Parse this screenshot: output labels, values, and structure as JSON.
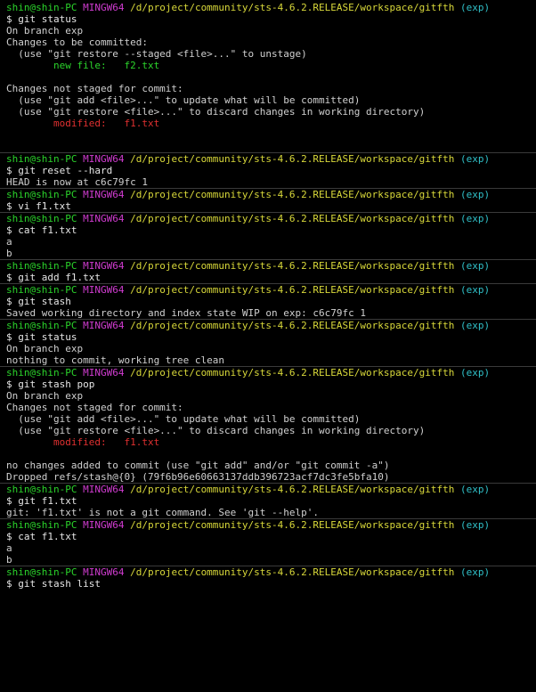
{
  "prompt": {
    "user": "shin@shin-PC",
    "shell": "MINGW64",
    "path": "/d/project/community/sts-4.6.2.RELEASE/workspace/gitfth",
    "branch": "(exp)"
  },
  "colors": {
    "user": "#2bd42b",
    "shell": "#d03cd0",
    "path": "#d8d83a",
    "branch": "#30c0c8",
    "status_red": "#e03030",
    "status_green": "#2bd42b",
    "text": "#d0d0d0"
  },
  "blocks": [
    {
      "command": "$ git status",
      "output": [
        {
          "text": "On branch exp"
        },
        {
          "text": "Changes to be committed:"
        },
        {
          "text": "  (use \"git restore --staged <file>...\" to unstage)"
        },
        {
          "text": "        new file:   f2.txt",
          "color": "green"
        },
        {
          "text": ""
        },
        {
          "text": "Changes not staged for commit:"
        },
        {
          "text": "  (use \"git add <file>...\" to update what will be committed)"
        },
        {
          "text": "  (use \"git restore <file>...\" to discard changes in working directory)"
        },
        {
          "text": "        modified:   f1.txt",
          "color": "red"
        },
        {
          "text": ""
        },
        {
          "text": ""
        }
      ],
      "show_prompt": false
    },
    {
      "command": "$ git reset --hard",
      "output": [
        {
          "text": "HEAD is now at c6c79fc 1"
        }
      ],
      "show_prompt": true
    },
    {
      "command": "$ vi f1.txt",
      "output": [],
      "show_prompt": true
    },
    {
      "command": "$ cat f1.txt",
      "output": [
        {
          "text": "a"
        },
        {
          "text": "b"
        }
      ],
      "show_prompt": true
    },
    {
      "command": "$ git add f1.txt",
      "output": [],
      "show_prompt": true
    },
    {
      "command": "$ git stash",
      "output": [
        {
          "text": "Saved working directory and index state WIP on exp: c6c79fc 1"
        }
      ],
      "show_prompt": true
    },
    {
      "command": "$ git status",
      "output": [
        {
          "text": "On branch exp"
        },
        {
          "text": "nothing to commit, working tree clean"
        }
      ],
      "show_prompt": true
    },
    {
      "command": "$ git stash pop",
      "output": [
        {
          "text": "On branch exp"
        },
        {
          "text": "Changes not staged for commit:"
        },
        {
          "text": "  (use \"git add <file>...\" to update what will be committed)"
        },
        {
          "text": "  (use \"git restore <file>...\" to discard changes in working directory)"
        },
        {
          "text": "        modified:   f1.txt",
          "color": "red"
        },
        {
          "text": ""
        },
        {
          "text": "no changes added to commit (use \"git add\" and/or \"git commit -a\")"
        },
        {
          "text": "Dropped refs/stash@{0} (79f6b96e60663137ddb396723acf7dc3fe5bfa10)"
        }
      ],
      "show_prompt": true
    },
    {
      "command": "$ git f1.txt",
      "output": [
        {
          "text": "git: 'f1.txt' is not a git command. See 'git --help'."
        }
      ],
      "show_prompt": true
    },
    {
      "command": "$ cat f1.txt",
      "output": [
        {
          "text": "a"
        },
        {
          "text": "b"
        }
      ],
      "show_prompt": true
    },
    {
      "command": "$ git stash list",
      "output": [],
      "show_prompt": true
    }
  ]
}
